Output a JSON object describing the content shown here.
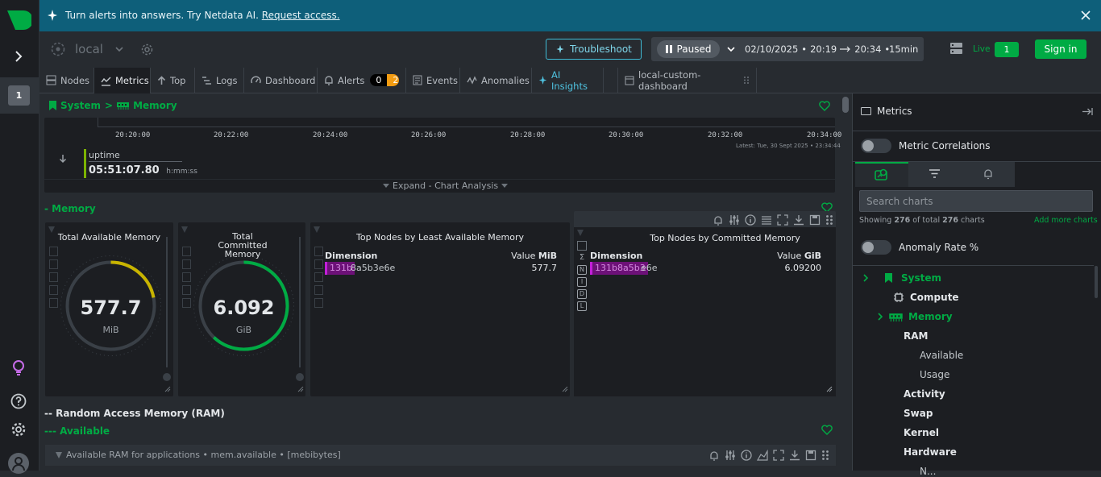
{
  "banner": {
    "text": "Turn alerts into answers. Try Netdata AI.",
    "link": "Request access."
  },
  "leftbar": {
    "space_badge": "1"
  },
  "topbar": {
    "node": "local",
    "troubleshoot": "Troubleshoot",
    "paused": "Paused",
    "date": "02/10/2025",
    "start_time": "20:19",
    "end_time": "20:34",
    "dot": "•",
    "duration": "15min",
    "live": "Live",
    "live_count": "1",
    "sign_in": "Sign in"
  },
  "tabs": [
    {
      "label": "Nodes"
    },
    {
      "label": "Metrics"
    },
    {
      "label": "Top"
    },
    {
      "label": "Logs"
    },
    {
      "label": "Dashboard"
    },
    {
      "label": "Alerts"
    },
    {
      "label": "Events"
    },
    {
      "label": "Anomalies"
    },
    {
      "label": "AI Insights"
    },
    {
      "label": "local-custom-dashboard"
    }
  ],
  "alerts": {
    "critical": "0",
    "warning": "2"
  },
  "breadcrumb": {
    "system": "System",
    "sep": ">",
    "memory": "Memory"
  },
  "timeline": {
    "ticks": [
      "20:20:00",
      "20:22:00",
      "20:24:00",
      "20:26:00",
      "20:28:00",
      "20:30:00",
      "20:32:00",
      "20:34:00"
    ],
    "latest_label": "Latest:",
    "latest_value": "Tue, 30 Sept 2025 • 23:34:44"
  },
  "uptime": {
    "label": "uptime",
    "value": "05:51:07.80",
    "unit": "h:mm:ss"
  },
  "expand": "Expand - Chart Analysis",
  "sections": {
    "memory": "- Memory",
    "ram": "-- Random Access Memory (RAM)",
    "available": "--- Available"
  },
  "gauges": [
    {
      "title": "Total Available Memory",
      "value": "577.7",
      "unit": "MiB",
      "fill": 0.22,
      "color": "#c8b400"
    },
    {
      "title": "Total Committed Memory",
      "value": "6.092",
      "unit": "GiB",
      "fill": 0.62,
      "color": "#00ab44"
    }
  ],
  "tables": [
    {
      "title": "Top Nodes by Least Available Memory",
      "dim_header": "Dimension",
      "value_header": "Value",
      "unit": "MiB",
      "node_hl": "131b",
      "node_rest": "8a5b3e6e",
      "value": "577.7"
    },
    {
      "title": "Top Nodes by Committed Memory",
      "dim_header": "Dimension",
      "value_header": "Value",
      "unit": "GiB",
      "node_hl": "131b8a5b3",
      "node_rest": "e6e",
      "value": "6.09200"
    }
  ],
  "sidebar_letters": [
    "Σ",
    "N",
    "I",
    "D",
    "L"
  ],
  "chart_bar": {
    "text": "Available RAM for applications • mem.available • [mebibytes]"
  },
  "right": {
    "title": "Metrics",
    "metric_correlations": "Metric Correlations",
    "search_placeholder": "Search charts",
    "showing_prefix": "Showing",
    "showing_count": "276",
    "showing_mid": "of total",
    "showing_total": "276",
    "showing_suffix": "charts",
    "add_more": "Add more charts",
    "anomaly_rate": "Anomaly Rate %",
    "tree": {
      "system": "System",
      "compute": "Compute",
      "memory": "Memory",
      "ram": "RAM",
      "available": "Available",
      "usage": "Usage",
      "activity": "Activity",
      "swap": "Swap",
      "kernel": "Kernel",
      "hardware": "Hardware",
      "partial": "N..."
    }
  }
}
